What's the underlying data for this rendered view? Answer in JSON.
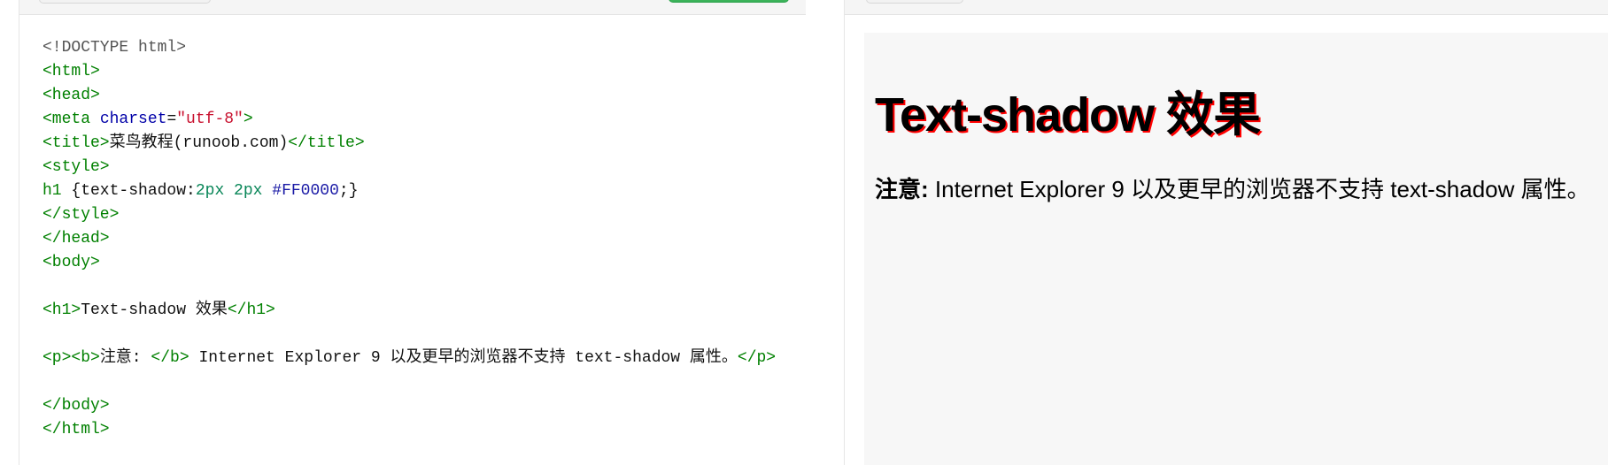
{
  "editor": {
    "lines": [
      [
        {
          "t": "<!DOCTYPE html>",
          "c": "c-doc"
        }
      ],
      [
        {
          "t": "<html>",
          "c": "c-tag"
        }
      ],
      [
        {
          "t": "<head>",
          "c": "c-tag"
        }
      ],
      [
        {
          "t": "<meta ",
          "c": "c-tag"
        },
        {
          "t": "charset",
          "c": "c-attr"
        },
        {
          "t": "=",
          "c": "c-txt"
        },
        {
          "t": "\"utf-8\"",
          "c": "c-str"
        },
        {
          "t": ">",
          "c": "c-tag"
        }
      ],
      [
        {
          "t": "<title>",
          "c": "c-tag"
        },
        {
          "t": "菜鸟教程(runoob.com)",
          "c": "c-txt"
        },
        {
          "t": "</title>",
          "c": "c-tag"
        }
      ],
      [
        {
          "t": "<style>",
          "c": "c-tag"
        }
      ],
      [
        {
          "t": "h1 ",
          "c": "c-tag"
        },
        {
          "t": "{text-shadow:",
          "c": "c-txt"
        },
        {
          "t": "2px 2px ",
          "c": "c-num"
        },
        {
          "t": "#FF0000",
          "c": "c-hex"
        },
        {
          "t": ";}",
          "c": "c-txt"
        }
      ],
      [
        {
          "t": "</style>",
          "c": "c-tag"
        }
      ],
      [
        {
          "t": "</head>",
          "c": "c-tag"
        }
      ],
      [
        {
          "t": "<body>",
          "c": "c-tag"
        }
      ],
      [],
      [
        {
          "t": "<h1>",
          "c": "c-tag"
        },
        {
          "t": "Text-shadow 效果",
          "c": "c-txt"
        },
        {
          "t": "</h1>",
          "c": "c-tag"
        }
      ],
      [],
      [
        {
          "t": "<p><b>",
          "c": "c-tag"
        },
        {
          "t": "注意: ",
          "c": "c-txt"
        },
        {
          "t": "</b>",
          "c": "c-tag"
        },
        {
          "t": " Internet Explorer 9 以及更早的浏览器不支持 text-shadow 属性。",
          "c": "c-txt"
        },
        {
          "t": "</p>",
          "c": "c-tag"
        }
      ],
      [],
      [
        {
          "t": "</body>",
          "c": "c-tag"
        }
      ],
      [
        {
          "t": "</html>",
          "c": "c-tag"
        }
      ]
    ]
  },
  "preview": {
    "heading": "Text-shadow 效果",
    "note_label": "注意:",
    "note_text": " Internet Explorer 9 以及更早的浏览器不支持 text-shadow 属性。"
  },
  "colors": {
    "shadow": "#FF0000",
    "run_button": "#3cb35a",
    "preview_bg": "#f7f7f7"
  }
}
